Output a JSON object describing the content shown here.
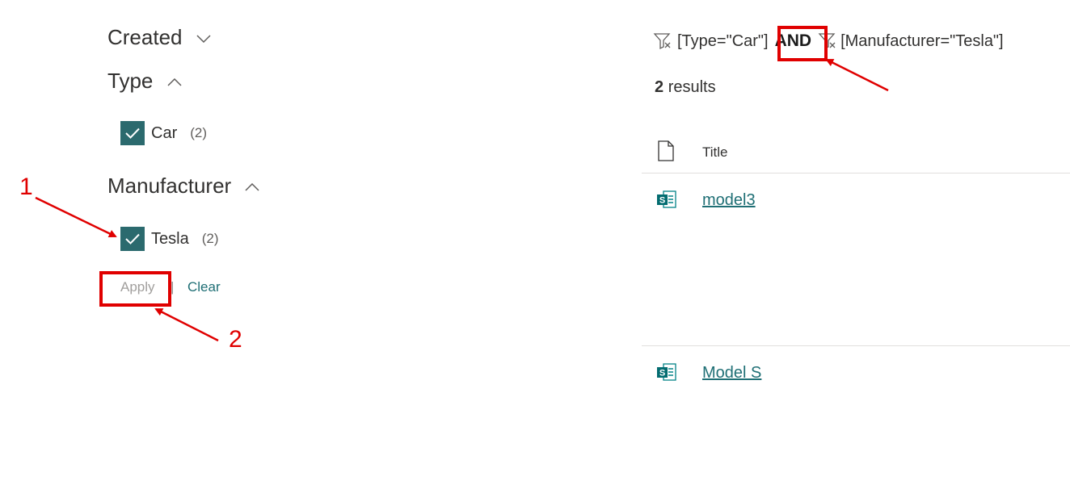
{
  "refiners": {
    "created": {
      "label": "Created"
    },
    "type": {
      "label": "Type",
      "options": [
        {
          "label": "Car",
          "count": "(2)",
          "checked": true
        }
      ]
    },
    "manufacturer": {
      "label": "Manufacturer",
      "options": [
        {
          "label": "Tesla",
          "count": "(2)",
          "checked": true
        }
      ]
    },
    "apply_label": "Apply",
    "separator": "|",
    "clear_label": "Clear"
  },
  "query": {
    "filter1": "[Type=\"Car\"]",
    "operator": "AND",
    "filter2": "[Manufacturer=\"Tesla\"]"
  },
  "results": {
    "count": "2",
    "count_suffix": "results",
    "title_header": "Title",
    "items": [
      {
        "title": "model3",
        "icon": "sharepoint-page-icon"
      },
      {
        "title": "Model S",
        "icon": "sharepoint-page-icon"
      }
    ]
  },
  "annotations": {
    "step1": "1",
    "step2": "2",
    "color": "#e00000"
  },
  "colors": {
    "checkbox": "#2b6a6e",
    "link": "#1f6f75",
    "divider": "#e1dfdd"
  }
}
